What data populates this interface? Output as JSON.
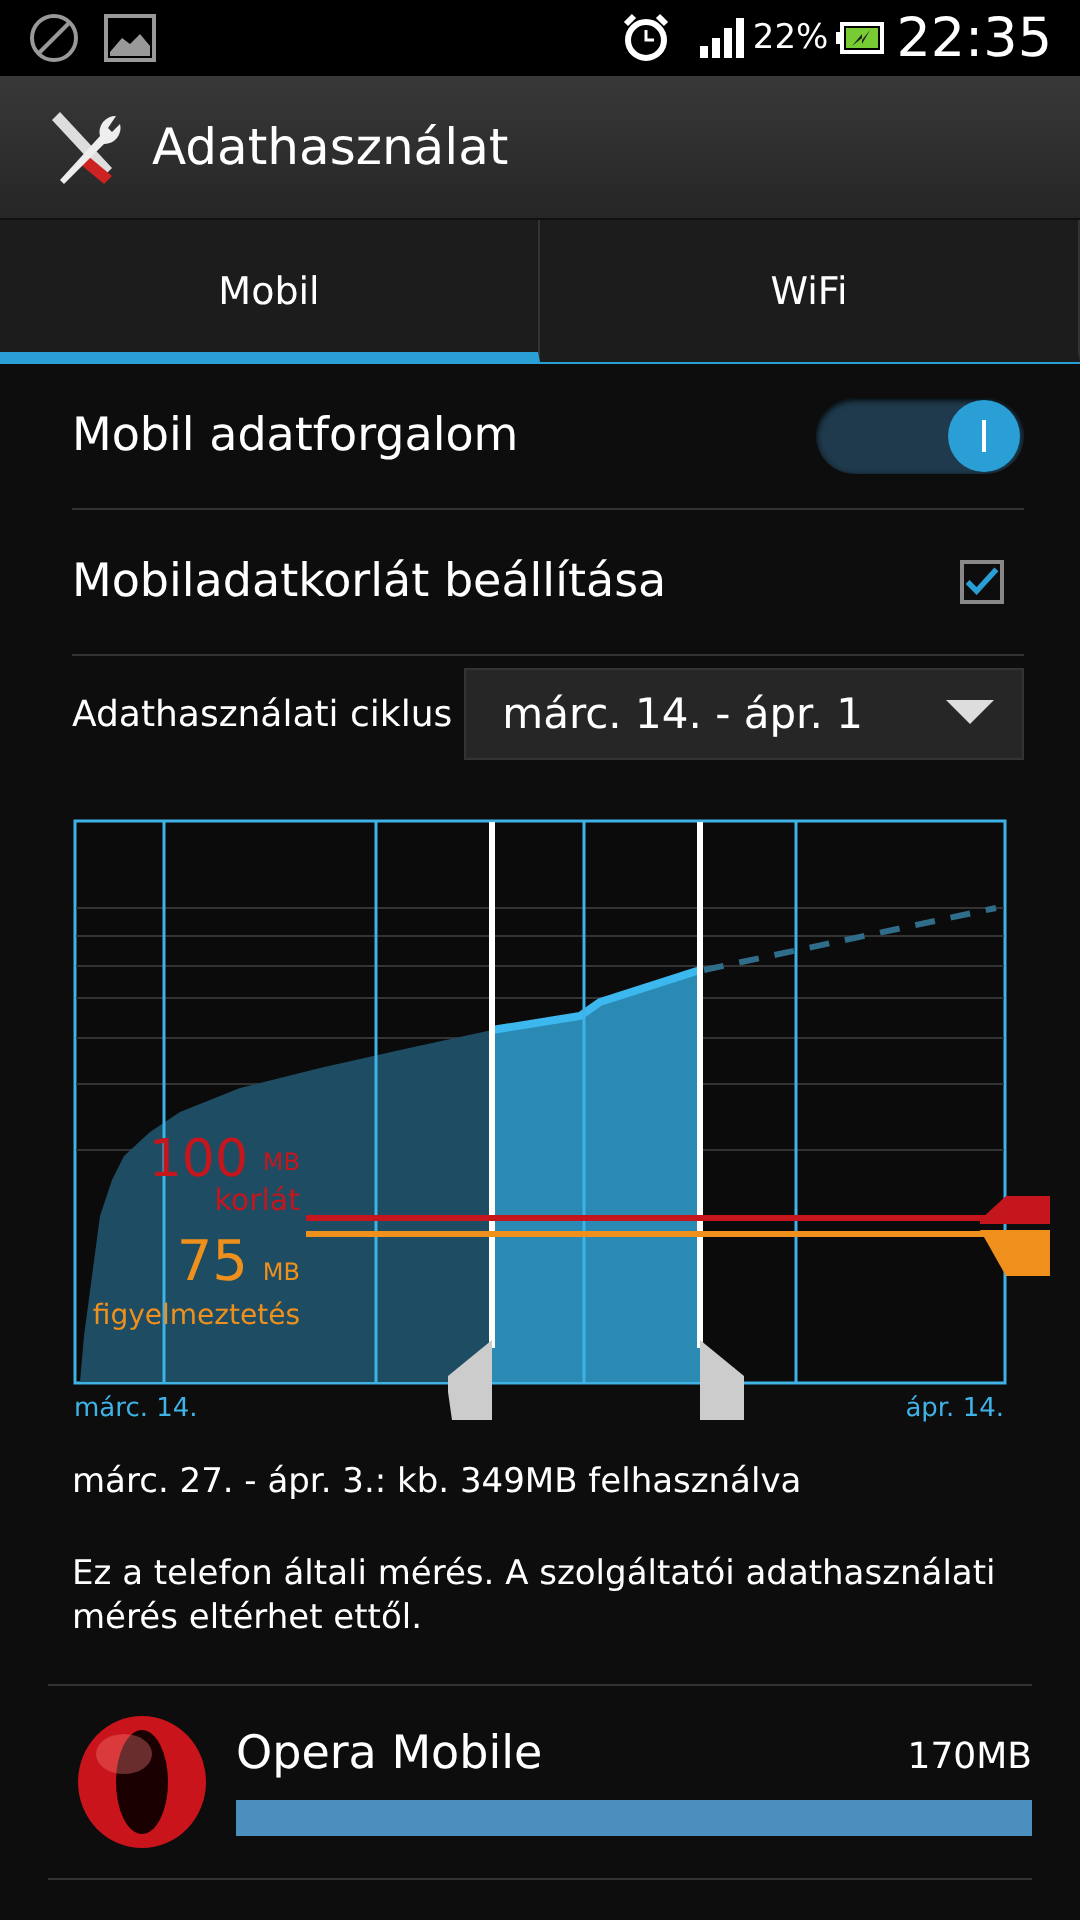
{
  "status_bar": {
    "battery_text": "22%",
    "time": "22:35"
  },
  "action_bar": {
    "title": "Adathasználat"
  },
  "tabs": [
    {
      "label": "Mobil",
      "selected": true
    },
    {
      "label": "WiFi",
      "selected": false
    }
  ],
  "settings": [
    {
      "kind": "toggle",
      "label": "Mobil adatforgalom",
      "on": true
    },
    {
      "kind": "checkbox",
      "label": "Mobiladatkorlát beállítása",
      "checked": true
    }
  ],
  "cycle": {
    "label": "Adathasználati ciklus",
    "value": "márc. 14. - ápr. 1"
  },
  "chart": {
    "limit": {
      "value": "100",
      "unit": "MB",
      "label": "korlát"
    },
    "warning": {
      "value": "75",
      "unit": "MB",
      "label": "figyelmeztetés"
    },
    "start_label": "márc. 14.",
    "end_label": "ápr. 14."
  },
  "summary": "márc. 27. - ápr. 3.: kb. 349MB felhasználva",
  "note": "Ez a telefon általi mérés. A szolgáltatói adathasználati mérés eltérhet ettől.",
  "apps": [
    {
      "name": "Opera Mobile",
      "usage": "170MB",
      "level": 1.0
    }
  ]
}
